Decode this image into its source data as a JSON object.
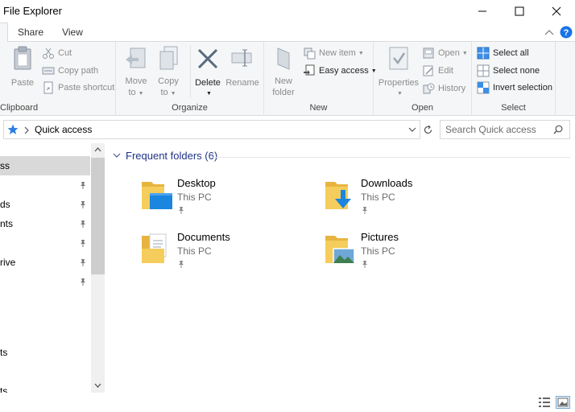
{
  "window": {
    "title": "File Explorer"
  },
  "tabs": [
    {
      "label": "Share"
    },
    {
      "label": "View"
    }
  ],
  "ribbon": {
    "clipboard": {
      "label": "Clipboard",
      "paste": "Paste",
      "cut": "Cut",
      "copy_path": "Copy path",
      "paste_shortcut": "Paste shortcut"
    },
    "organize": {
      "label": "Organize",
      "move_to_1": "Move",
      "move_to_2": "to",
      "copy_to_1": "Copy",
      "copy_to_2": "to",
      "delete": "Delete",
      "rename": "Rename"
    },
    "new": {
      "label": "New",
      "new_folder_1": "New",
      "new_folder_2": "folder",
      "new_item": "New item",
      "easy_access": "Easy access"
    },
    "open": {
      "label": "Open",
      "properties": "Properties",
      "open": "Open",
      "edit": "Edit",
      "history": "History"
    },
    "select": {
      "label": "Select",
      "select_all": "Select all",
      "select_none": "Select none",
      "invert_selection": "Invert selection"
    }
  },
  "address": {
    "crumb": "Quick access"
  },
  "search": {
    "placeholder": "Search Quick access"
  },
  "nav": {
    "items": [
      {
        "label": "ss"
      },
      {
        "label": "ds"
      },
      {
        "label": "nts"
      },
      {
        "label": ""
      },
      {
        "label": "rive"
      },
      {
        "label": ""
      },
      {
        "label": "ts"
      },
      {
        "label": "ts"
      }
    ]
  },
  "content": {
    "group_title": "Frequent folders (6)",
    "folders": [
      {
        "name": "Desktop",
        "location": "This PC",
        "icon": "desktop-folder-icon"
      },
      {
        "name": "Downloads",
        "location": "This PC",
        "icon": "downloads-folder-icon"
      },
      {
        "name": "Documents",
        "location": "This PC",
        "icon": "documents-folder-icon"
      },
      {
        "name": "Pictures",
        "location": "This PC",
        "icon": "pictures-folder-icon"
      }
    ]
  },
  "colors": {
    "accent": "#1e3287",
    "folder": "#f5cd5c",
    "help": "#1a73e8",
    "ribbon_bg": "#f5f6f7"
  }
}
